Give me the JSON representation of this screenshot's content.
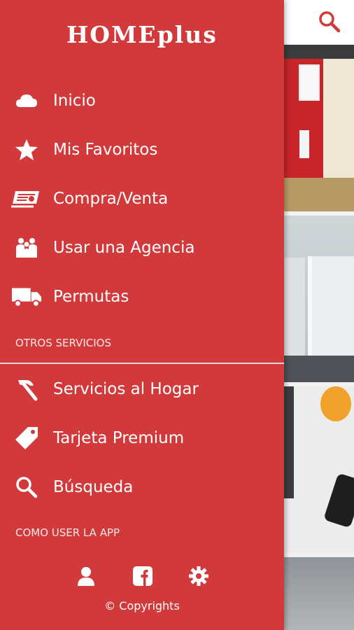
{
  "app": {
    "brand": "HOMEplus"
  },
  "toolbar": {
    "search_icon": "search-icon"
  },
  "drawer": {
    "items": [
      {
        "label": "Inicio",
        "icon": "cloud-icon"
      },
      {
        "label": "Mis Favoritos",
        "icon": "star-icon"
      },
      {
        "label": "Compra/Venta",
        "icon": "money-icon"
      },
      {
        "label": "Usar una Agencia",
        "icon": "people-icon"
      },
      {
        "label": "Permutas",
        "icon": "truck-icon"
      }
    ],
    "section_other": "OTROS SERVICIOS",
    "other_items": [
      {
        "label": "Servicios al Hogar",
        "icon": "hammer-icon"
      },
      {
        "label": "Tarjeta Premium",
        "icon": "tag-icon"
      },
      {
        "label": "Búsqueda",
        "icon": "search-icon"
      }
    ],
    "section_howto": "COMO USER LA APP",
    "footer": {
      "icons": [
        "user-icon",
        "facebook-icon",
        "gear-icon"
      ],
      "copyright": "© Copyrights"
    }
  },
  "colors": {
    "drawer": "#d1393b",
    "accent": "#c8252b"
  }
}
